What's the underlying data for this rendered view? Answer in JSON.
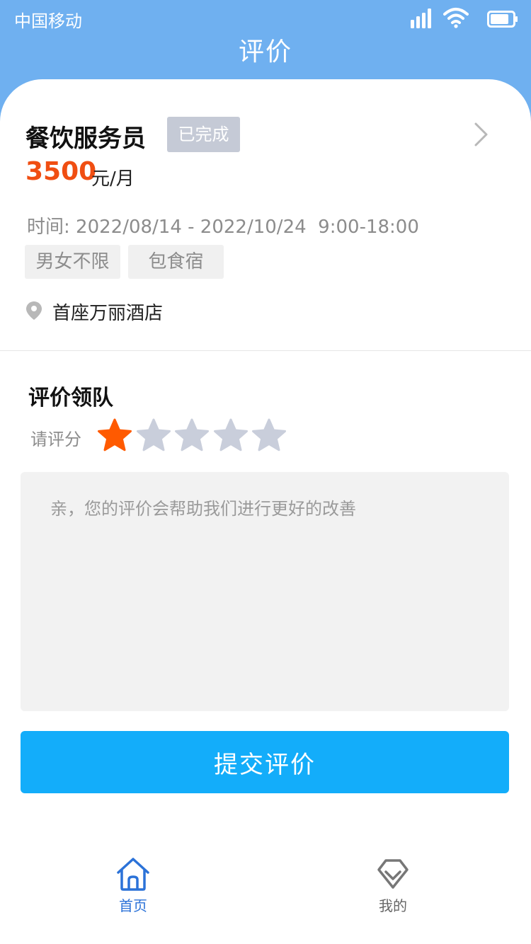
{
  "status_bar": {
    "carrier": "中国移动",
    "icons": [
      "signal-icon",
      "wifi-icon",
      "battery-icon"
    ]
  },
  "header": {
    "title": "评价",
    "background_color": "#6fb0f0"
  },
  "job": {
    "title": "餐饮服务员",
    "status": "已完成",
    "salary": "3500",
    "salary_unit": "元/月",
    "time_label": "时间:",
    "time_value": "2022/08/14 - 2022/10/24  9:00-18:00",
    "tags": [
      "男女不限",
      "包食宿"
    ],
    "location": "首座万丽酒店"
  },
  "review": {
    "section_title": "评价领队",
    "rate_label": "请评分",
    "rating": 1,
    "max_rating": 5,
    "star_active_color": "#ff5a00",
    "star_inactive_color": "#c9cedb",
    "placeholder": "亲，您的评价会帮助我们进行更好的改善",
    "submit_label": "提交评价",
    "submit_color": "#13adfa"
  },
  "tabbar": {
    "items": [
      {
        "label": "首页",
        "icon": "home-icon",
        "active": true
      },
      {
        "label": "我的",
        "icon": "diamond-heart-icon",
        "active": false
      }
    ],
    "active_color": "#2b72d8"
  }
}
